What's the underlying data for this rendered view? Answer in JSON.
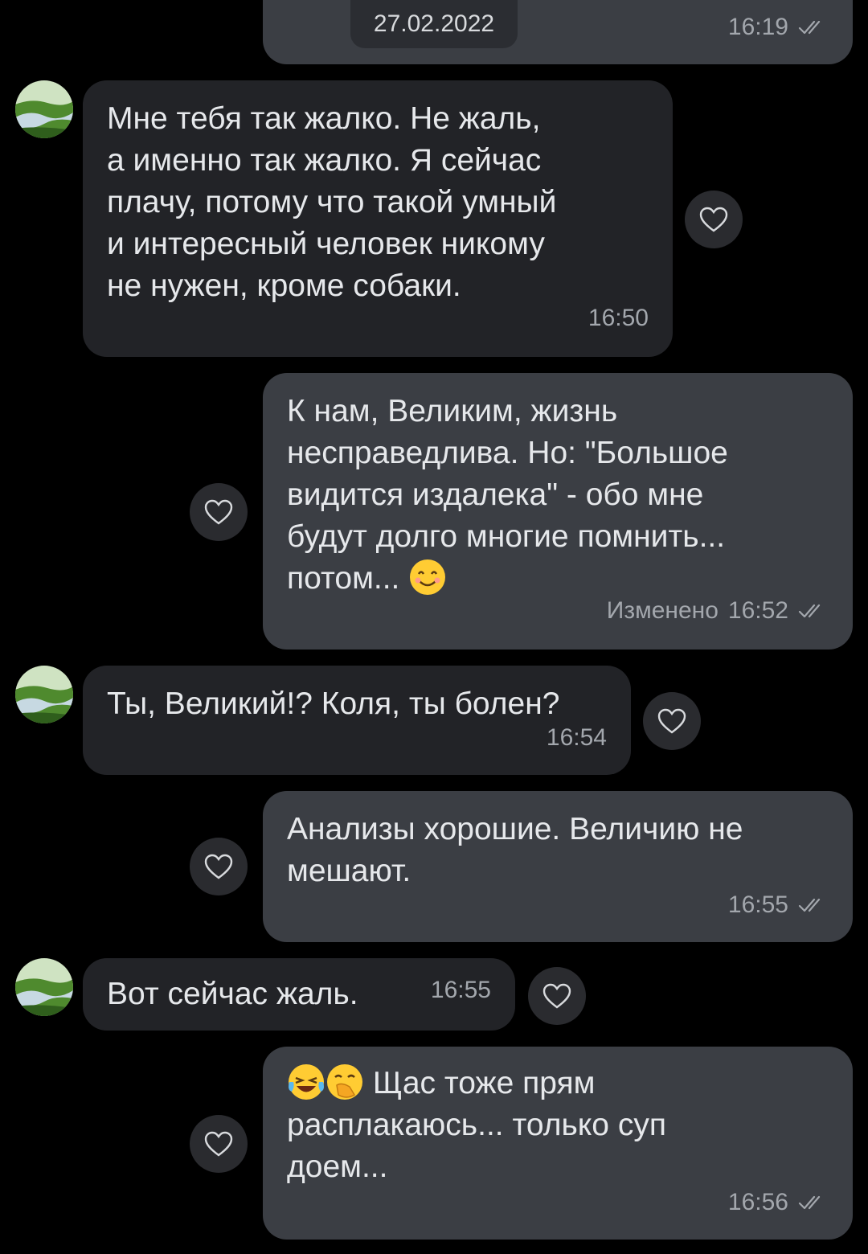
{
  "date_chip": "27.02.2022",
  "messages": [
    {
      "text": "",
      "time": "16:19"
    },
    {
      "text": "Мне тебя так жалко. Не жаль,\nа именно так жалко. Я сейчас\nплачу, потому что такой умный\nи интересный человек никому\nне нужен, кроме собаки.",
      "time": "16:50"
    },
    {
      "text": "К нам, Великим, жизнь\nнесправедлива. Но: \"Большое\nвидится издалека\" - обо мне\nбудут долго многие помнить...\nпотом...",
      "time": "16:52",
      "edited_label": "Изменено"
    },
    {
      "text": "Ты, Великий!? Коля, ты болен?",
      "time": "16:54"
    },
    {
      "text": "Анализы хорошие. Величию не\nмешают.",
      "time": "16:55"
    },
    {
      "text": "Вот сейчас жаль.",
      "time": "16:55"
    },
    {
      "text": "Щас тоже прям\nрасплакаюсь... только суп\nдоем...",
      "time": "16:56"
    }
  ],
  "icons": {
    "like": "heart-outline-icon",
    "read": "double-check-icon",
    "emoji_smile": "smiling-face-icon",
    "emoji_laugh": "tears-of-joy-icon",
    "emoji_giggle": "hand-over-mouth-icon"
  },
  "colors": {
    "background": "#000000",
    "incoming_bubble": "#222327",
    "outgoing_bubble": "#3b3e44",
    "meta_text": "#a3a7ad"
  }
}
